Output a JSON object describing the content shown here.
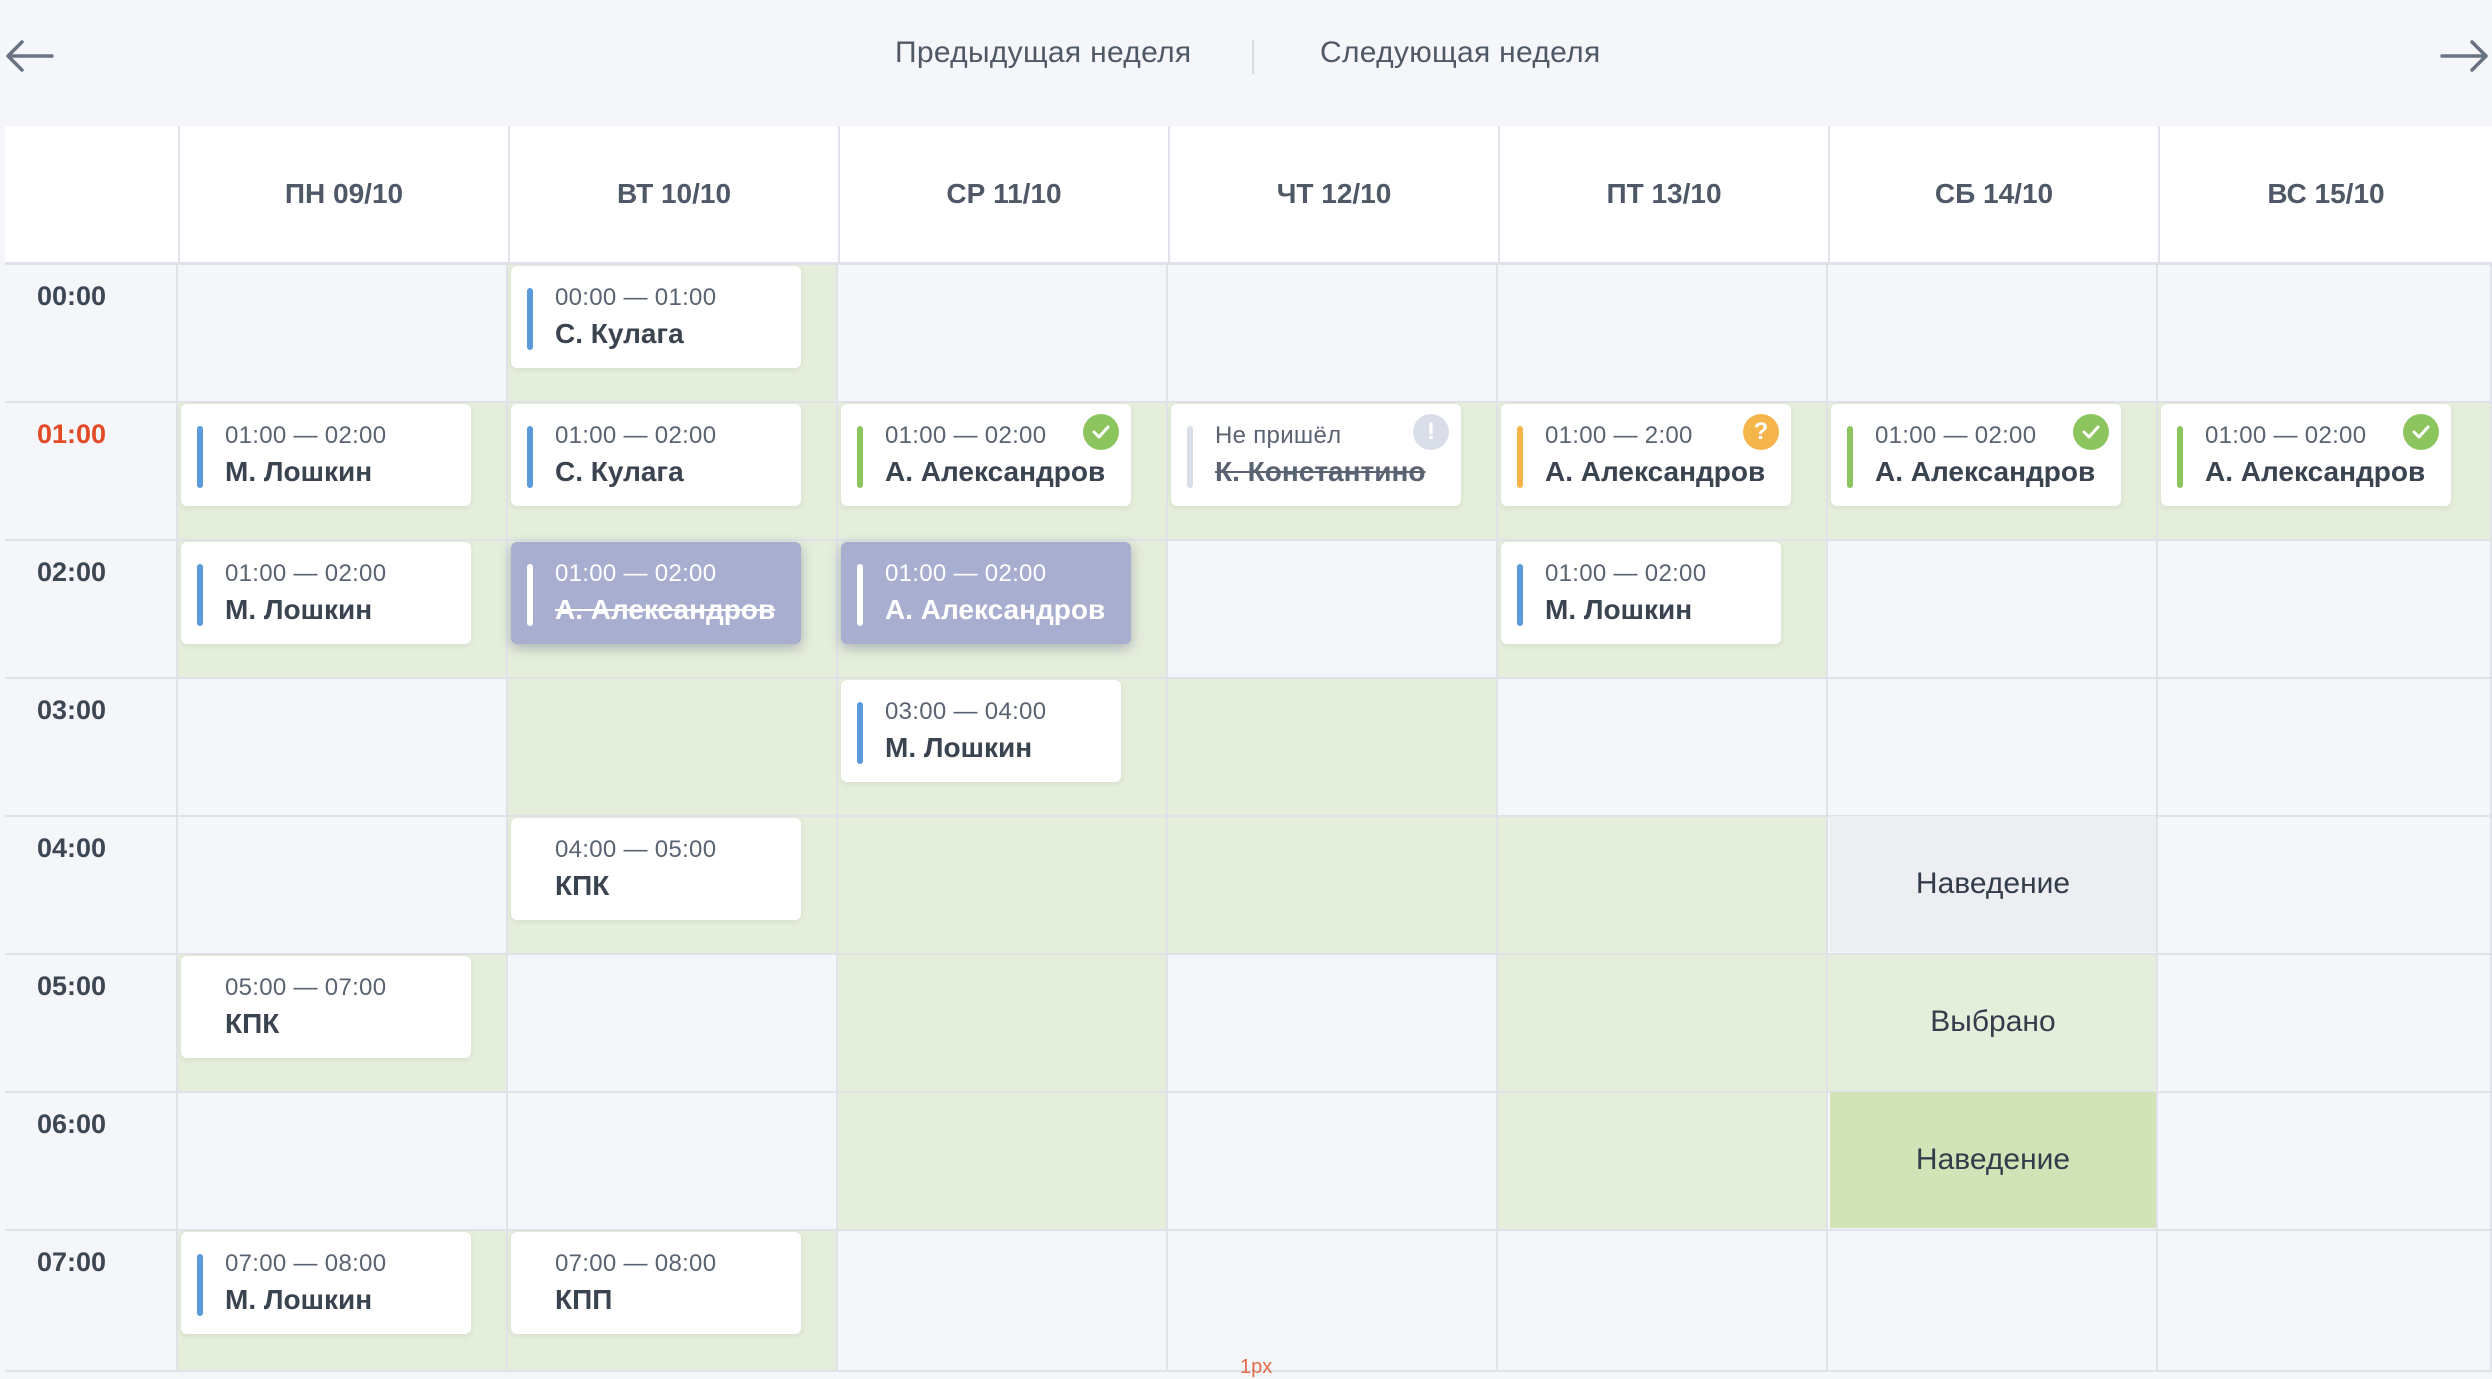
{
  "nav": {
    "prev_label": "Предыдущая неделя",
    "next_label": "Следующая неделя",
    "back_icon": "arrow-left-icon",
    "forward_icon": "arrow-right-icon"
  },
  "days": [
    {
      "label": "ПН 09/10"
    },
    {
      "label": "ВТ 10/10"
    },
    {
      "label": "СР 11/10"
    },
    {
      "label": "ЧТ 12/10"
    },
    {
      "label": "ПТ 13/10"
    },
    {
      "label": "СБ 14/10"
    },
    {
      "label": "ВС 15/10"
    }
  ],
  "hours": [
    "00:00",
    "01:00",
    "02:00",
    "03:00",
    "04:00",
    "05:00",
    "06:00",
    "07:00"
  ],
  "current_hour": "01:00",
  "colors": {
    "available_bg": "#e5eddb",
    "cell_bg": "#f4f6f9",
    "blue": "#5b9bdb",
    "green": "#8cc45e",
    "orange": "#f5b54a",
    "gray": "#d9dee8",
    "selected_bg": "#a7aed0",
    "current_hour": "#e24b26"
  },
  "events": {
    "mon_01": {
      "time": "01:00 — 02:00",
      "name": "М. Лошкин",
      "bar": "blue"
    },
    "mon_02": {
      "time": "01:00 — 02:00",
      "name": "М. Лошкин",
      "bar": "blue"
    },
    "mon_05": {
      "time": "05:00 — 07:00",
      "name": "КПК"
    },
    "mon_07": {
      "time": "07:00 — 08:00",
      "name": "М. Лошкин",
      "bar": "blue"
    },
    "tue_00": {
      "time": "00:00 — 01:00",
      "name": "С. Кулага",
      "bar": "blue"
    },
    "tue_01": {
      "time": "01:00 — 02:00",
      "name": "С. Кулага",
      "bar": "blue"
    },
    "tue_02": {
      "time": "01:00 — 02:00",
      "name": "А. Александров",
      "state": "selected, cancelled"
    },
    "tue_04": {
      "time": "04:00 — 05:00",
      "name": "КПК"
    },
    "tue_07": {
      "time": "07:00 — 08:00",
      "name": "КПП"
    },
    "wed_01": {
      "time": "01:00 — 02:00",
      "name": "А. Александров",
      "bar": "green",
      "status": "check-icon"
    },
    "wed_02": {
      "time": "01:00 — 02:00",
      "name": "А. Александров",
      "state": "selected"
    },
    "wed_03": {
      "time": "03:00 — 04:00",
      "name": "М. Лошкин",
      "bar": "blue"
    },
    "thu_01": {
      "time": "Не пришёл",
      "name": "К. Константино",
      "bar": "gray",
      "status": "exclamation-icon"
    },
    "fri_01": {
      "time": "01:00 — 2:00",
      "name": "А. Александров",
      "bar": "orange",
      "status": "question-icon"
    },
    "fri_02": {
      "time": "01:00 — 02:00",
      "name": "М. Лошкин",
      "bar": "blue"
    },
    "sat_01": {
      "time": "01:00 — 02:00",
      "name": "А. Александров",
      "bar": "green",
      "status": "check-icon"
    },
    "sun_01": {
      "time": "01:00 — 02:00",
      "name": "А. Александров",
      "bar": "green",
      "status": "check-icon"
    }
  },
  "slot_states": {
    "sat_04": "Наведение",
    "sat_05": "Выбрано",
    "sat_06": "Наведение"
  },
  "footnote": "1px"
}
